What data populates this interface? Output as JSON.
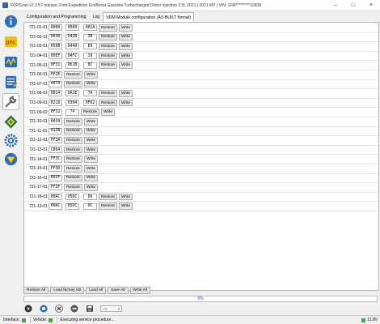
{
  "window": {
    "title": "FORScan v2.3.57 release, Ford Expedition EcoBoost Gasoline Turbocharged Direct Injection 3.5L 2021 | 2021 MY | VIN: 1FM*********10608",
    "btn_minimize": "–",
    "btn_maximize": "□",
    "btn_close": "×"
  },
  "tabs": [
    {
      "label": "Configuration and Programming"
    },
    {
      "label": "Log"
    },
    {
      "label": "VDM Module configuration (AS BUILT format)"
    }
  ],
  "sidebar": {
    "items": [
      {
        "icon": "info-icon"
      },
      {
        "icon": "dtc-icon"
      },
      {
        "icon": "oscilloscope-icon"
      },
      {
        "icon": "checklist-icon"
      },
      {
        "icon": "wrench-icon"
      },
      {
        "icon": "module-diamond-icon"
      },
      {
        "icon": "settings-gear-icon"
      },
      {
        "icon": "ford-badge-icon"
      }
    ]
  },
  "buttons": {
    "restore": "Restore",
    "write": "Write"
  },
  "rows": [
    {
      "addr": "721-01-01",
      "values": [
        "0000",
        "0000",
        "002A"
      ]
    },
    {
      "addr": "721-02-01",
      "values": [
        "0030",
        "042B",
        "38"
      ]
    },
    {
      "addr": "721-03-01",
      "values": [
        "056B",
        "0440",
        "E9"
      ]
    },
    {
      "addr": "721-04-01",
      "values": [
        "00EF",
        "04FC",
        "29"
      ]
    },
    {
      "addr": "721-05-01",
      "values": [
        "0F31",
        "061B",
        "8C"
      ]
    },
    {
      "addr": "721-06-01",
      "values": [
        "FF2E"
      ]
    },
    {
      "addr": "721-07-01",
      "values": [
        "4070"
      ]
    },
    {
      "addr": "721-08-01",
      "values": [
        "0D14",
        "0A1E",
        "7A"
      ]
    },
    {
      "addr": "721-09-01",
      "values": [
        "0218",
        "0304",
        "0F62"
      ]
    },
    {
      "addr": "721-09-02",
      "values": [
        "0F32",
        "74"
      ]
    },
    {
      "addr": "721-10-01",
      "values": [
        "0039"
      ]
    },
    {
      "addr": "721-11-01",
      "values": [
        "013B"
      ]
    },
    {
      "addr": "721-12-01",
      "values": [
        "FF3A"
      ]
    },
    {
      "addr": "721-13-01",
      "values": [
        "C804"
      ]
    },
    {
      "addr": "721-14-01",
      "values": [
        "FF3C"
      ]
    },
    {
      "addr": "721-15-01",
      "values": [
        "FF3D"
      ]
    },
    {
      "addr": "721-16-01",
      "values": [
        "003F"
      ]
    },
    {
      "addr": "721-17-01",
      "values": [
        "FF3F"
      ]
    },
    {
      "addr": "721-18-01",
      "values": [
        "00AC",
        "05DC",
        "D6"
      ]
    },
    {
      "addr": "721-19-01",
      "values": [
        "00AC",
        "05DC",
        "0C"
      ]
    }
  ],
  "bottom_buttons": [
    {
      "label": "Restore All"
    },
    {
      "label": "Load factory AB"
    },
    {
      "label": "Load All"
    },
    {
      "label": "Save All"
    },
    {
      "label": "Write All"
    }
  ],
  "progress": {
    "text": "0%",
    "value": 0
  },
  "combo": {
    "value": "AB"
  },
  "status": {
    "interface_label": "Interface:",
    "vehicle_label": "Vehicle:",
    "message": "Executing service procedure...",
    "voltage": "11.8V"
  },
  "colors": {
    "ok_green": "#3aa83a",
    "accent": "#2a3fa0"
  }
}
